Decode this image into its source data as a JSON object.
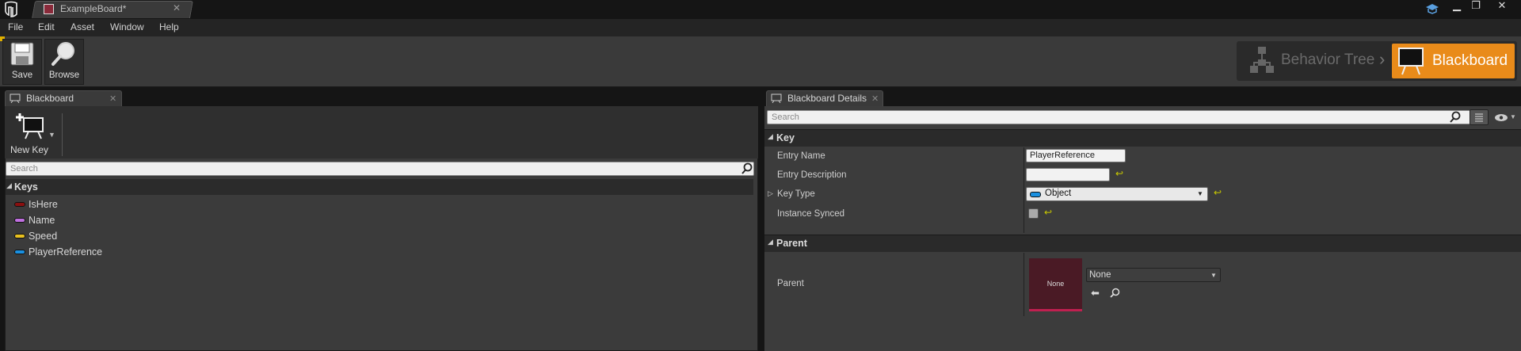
{
  "titlebar": {
    "tab_title": "ExampleBoard*",
    "minimize": "▁",
    "restore": "❐",
    "close": "✕"
  },
  "menu": [
    "File",
    "Edit",
    "Asset",
    "Window",
    "Help"
  ],
  "toolbar": {
    "save_label": "Save",
    "browse_label": "Browse"
  },
  "modes": {
    "behavior_tree": "Behavior Tree",
    "blackboard": "Blackboard"
  },
  "blackboard_panel": {
    "tab_label": "Blackboard",
    "new_key_label": "New Key",
    "search_placeholder": "Search",
    "keys_header": "Keys",
    "keys": [
      {
        "name": "IsHere",
        "color": "#8a1010"
      },
      {
        "name": "Name",
        "color": "#c070e0"
      },
      {
        "name": "Speed",
        "color": "#e8c020"
      },
      {
        "name": "PlayerReference",
        "color": "#1a90e0"
      }
    ]
  },
  "details_panel": {
    "tab_label": "Blackboard Details",
    "search_placeholder": "Search",
    "key_category": "Key",
    "entry_name_label": "Entry Name",
    "entry_name_value": "PlayerReference",
    "entry_description_label": "Entry Description",
    "entry_description_value": "",
    "key_type_label": "Key Type",
    "key_type_value": "Object",
    "instance_synced_label": "Instance Synced",
    "parent_category": "Parent",
    "parent_label": "Parent",
    "parent_thumbnail": "None",
    "parent_value": "None"
  },
  "colors": {
    "accent": "#e98b1a",
    "object_type": "#1a90e0"
  }
}
